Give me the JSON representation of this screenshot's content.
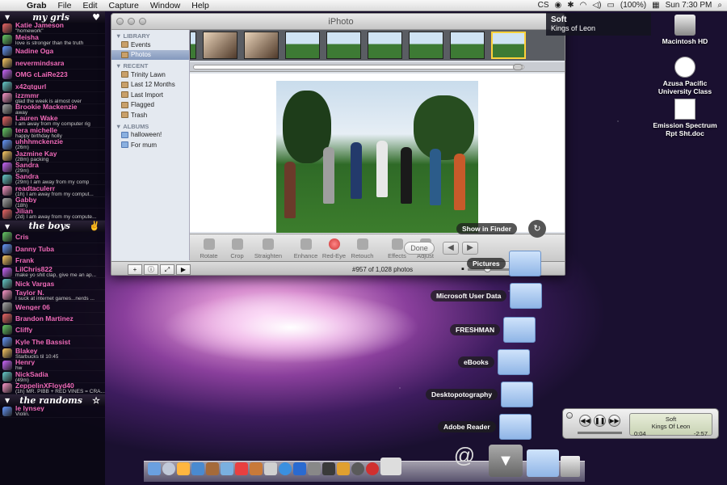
{
  "menubar": {
    "app": "Grab",
    "items": [
      "File",
      "Edit",
      "Capture",
      "Window",
      "Help"
    ],
    "battery": "(100%)",
    "clock": "Sun 7:30 PM",
    "cs": "CS"
  },
  "buddy_list": {
    "groups": [
      {
        "name": "my grls",
        "buddies": [
          {
            "name": "Katie Jameson",
            "status": "\"homework\""
          },
          {
            "name": "Meisha",
            "status": "love is stronger than the truth"
          },
          {
            "name": "Nadine Oga",
            "status": ""
          },
          {
            "name": "nevermindsara",
            "status": ""
          },
          {
            "name": "OMG cLaiRe223",
            "status": ""
          },
          {
            "name": "x42qtgurl",
            "status": ""
          },
          {
            "name": "izzmmr",
            "status": "glad the week is almost over"
          },
          {
            "name": "Brookie Mackenzie",
            "status": "away"
          },
          {
            "name": "Lauren Wake",
            "status": "I am away from my computer rig"
          },
          {
            "name": "tera michelle",
            "status": "happy birthday holly"
          },
          {
            "name": "uhhhmckenzie",
            "status": "(26m)"
          },
          {
            "name": "Jazmine Kay",
            "status": "(28m) packing"
          },
          {
            "name": "Sandra",
            "status": "(29m)"
          },
          {
            "name": "Sandra",
            "status": "(29m) I am away from my comp"
          },
          {
            "name": "readtaculerr",
            "status": "(1h) I am away from my comput..."
          },
          {
            "name": "Gabby",
            "status": "(18h)"
          },
          {
            "name": "Jilian",
            "status": "(2d) I am away from my compute..."
          }
        ]
      },
      {
        "name": "the boys",
        "buddies": [
          {
            "name": "Cris",
            "status": ""
          },
          {
            "name": "Danny Tuba",
            "status": ""
          },
          {
            "name": "Frank",
            "status": ""
          },
          {
            "name": "LilChris822",
            "status": "make yo shit clap, give me an ap..."
          },
          {
            "name": "Nick Vargas",
            "status": ""
          },
          {
            "name": "Taylor N.",
            "status": "I suck at internet games...nerds ..."
          },
          {
            "name": "Wenger 06",
            "status": ""
          },
          {
            "name": "Brandon Martinez",
            "status": ""
          },
          {
            "name": "Cliffy",
            "status": ""
          },
          {
            "name": "Kyle The Bassist",
            "status": ""
          },
          {
            "name": "Blakey",
            "status": "Starbucks til 10:45"
          },
          {
            "name": "Henry",
            "status": "hw"
          },
          {
            "name": "NickSadia",
            "status": "(49m)"
          },
          {
            "name": "ZeppelinXFloyd40",
            "status": "(1h) MR. PIBB + RED VINES = CRA..."
          }
        ]
      },
      {
        "name": "the randoms",
        "buddies": [
          {
            "name": "le lynsey",
            "status": "Violin."
          }
        ]
      }
    ]
  },
  "iphoto": {
    "title": "iPhoto",
    "library_header": "LIBRARY",
    "library": [
      "Events",
      "Photos"
    ],
    "recent_header": "RECENT",
    "recent": [
      "Trinity Lawn",
      "Last 12 Months",
      "Last Import",
      "Flagged",
      "Trash"
    ],
    "albums_header": "ALBUMS",
    "albums": [
      "halloween!",
      "For mum"
    ],
    "tools": [
      "Rotate",
      "Crop",
      "Straighten",
      "Enhance",
      "Red-Eye",
      "Retouch",
      "Effects",
      "Adjust"
    ],
    "done": "Done",
    "count": "#957 of 1,028 photos"
  },
  "notification": {
    "title": "Soft",
    "artist": "Kings of Leon"
  },
  "desktop_icons": [
    "Macintosh HD",
    "Azusa Pacific University Class",
    "Emission Spectrum Rpt Sht.doc"
  ],
  "stack": {
    "show_in_finder": "Show in Finder",
    "folders": [
      "Pictures",
      "Microsoft User Data",
      "FRESHMAN",
      "eBooks",
      "Desktopotography",
      "Adobe Reader"
    ]
  },
  "itunes": {
    "track": "Soft",
    "artist": "Kings Of Leon",
    "elapsed": "0:04",
    "remaining": "-2:57"
  }
}
